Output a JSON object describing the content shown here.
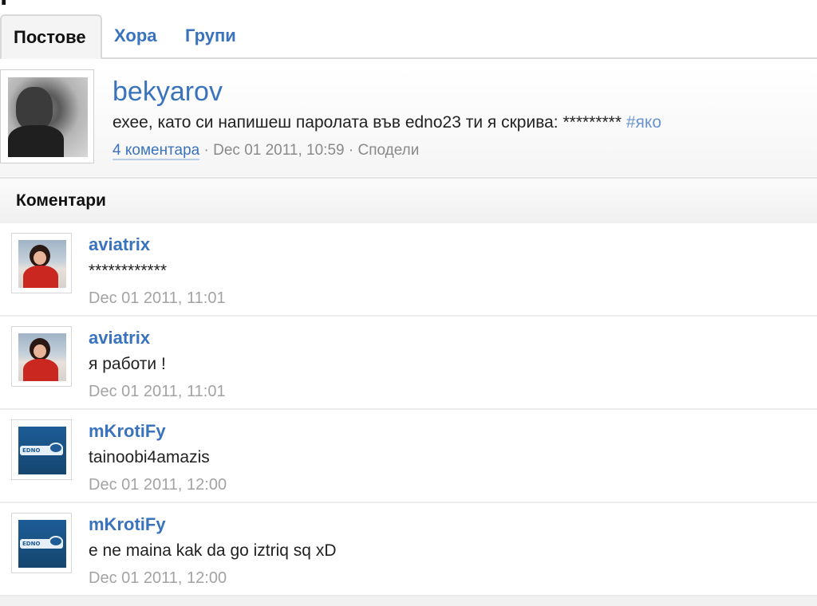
{
  "page": {
    "cut_title": "р"
  },
  "tabs": [
    {
      "label": "Постове",
      "active": true
    },
    {
      "label": "Хора",
      "active": false
    },
    {
      "label": "Групи",
      "active": false
    }
  ],
  "post": {
    "author": "bekyarov",
    "text": "ехее, като си напишеш паролата във edno23 ти я скрива: *********",
    "hashtag": "#яко",
    "comments_link": "4 коментара",
    "separator": " · ",
    "timestamp": "Dec 01 2011, 10:59",
    "share_label": "Сподели"
  },
  "comments_section": {
    "title": "Коментари",
    "items": [
      {
        "author": "aviatrix",
        "text": "************",
        "time": "Dec 01 2011, 11:01",
        "avatar": "girl"
      },
      {
        "author": "aviatrix",
        "text": "я работи !",
        "time": "Dec 01 2011, 11:01",
        "avatar": "girl"
      },
      {
        "author": "mKrotiFy",
        "text": "tainoobi4amazis",
        "time": "Dec 01 2011, 12:00",
        "avatar": "edno"
      },
      {
        "author": "mKrotiFy",
        "text": "e ne maina kak da go iztriq sq xD",
        "time": "Dec 01 2011, 12:00",
        "avatar": "edno"
      }
    ]
  },
  "colors": {
    "link": "#3a73bd",
    "hashtag": "#6a94cf",
    "muted": "#a3a3a3",
    "border": "#d9d9d9"
  },
  "avatar_logo_text": "EDNO"
}
